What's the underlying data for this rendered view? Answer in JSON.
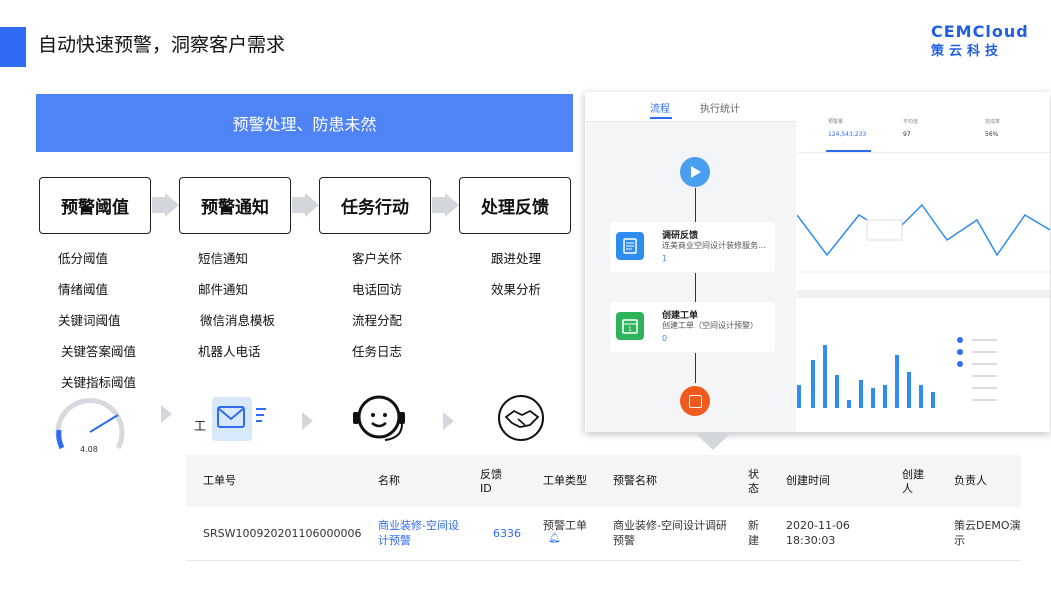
{
  "header": {
    "title": "自动快速预警，洞察客户需求",
    "logo_top": "CEMCloud",
    "logo_bottom": "策云科技"
  },
  "banner": "预警处理、防患未然",
  "stages": [
    {
      "label": "预警阈值",
      "items": [
        "低分阈值",
        "情绪阈值",
        "关键词阈值",
        "关键答案阈值",
        "关键指标阈值"
      ]
    },
    {
      "label": "预警通知",
      "items": [
        "短信通知",
        "邮件通知",
        "微信消息模板",
        "机器人电话"
      ]
    },
    {
      "label": "任务行动",
      "items": [
        "客户关怀",
        "电话回访",
        "流程分配",
        "任务日志"
      ]
    },
    {
      "label": "处理反馈",
      "items": [
        "跟进处理",
        "效果分析"
      ]
    }
  ],
  "gauge_value": "4.08",
  "small_label": "工",
  "flow_panel": {
    "tabs": [
      "流程",
      "执行统计"
    ],
    "node1": {
      "title": "调研反馈",
      "sub": "连美商业空间设计装修服务...",
      "meta": "1"
    },
    "node2": {
      "title": "创建工单",
      "sub": "创建工单（空间设计预警）",
      "meta": "0"
    }
  },
  "stats": [
    {
      "label": "预警量",
      "value": "124,543,233"
    },
    {
      "label": "平均值",
      "value": "97"
    },
    {
      "label": "完成率",
      "value": "56%"
    }
  ],
  "table": {
    "headers": [
      "工单号",
      "名称",
      "反馈ID",
      "工单类型",
      "预警名称",
      "状态",
      "创建时间",
      "创建人",
      "负责人"
    ],
    "row": {
      "id": "SRSW100920201106000006",
      "name": "商业装修-空间设计预警",
      "feedback_id": "6336",
      "type": "预警工单",
      "alert_name": "商业装修-空间设计调研预警",
      "status": "新建",
      "created_at": "2020-11-06 18:30:03",
      "creator": "",
      "owner": "策云DEMO演示"
    }
  },
  "colors": {
    "accent": "#2f6bf5",
    "banner": "#4f84f7",
    "arrow": "#d3d7dc"
  }
}
